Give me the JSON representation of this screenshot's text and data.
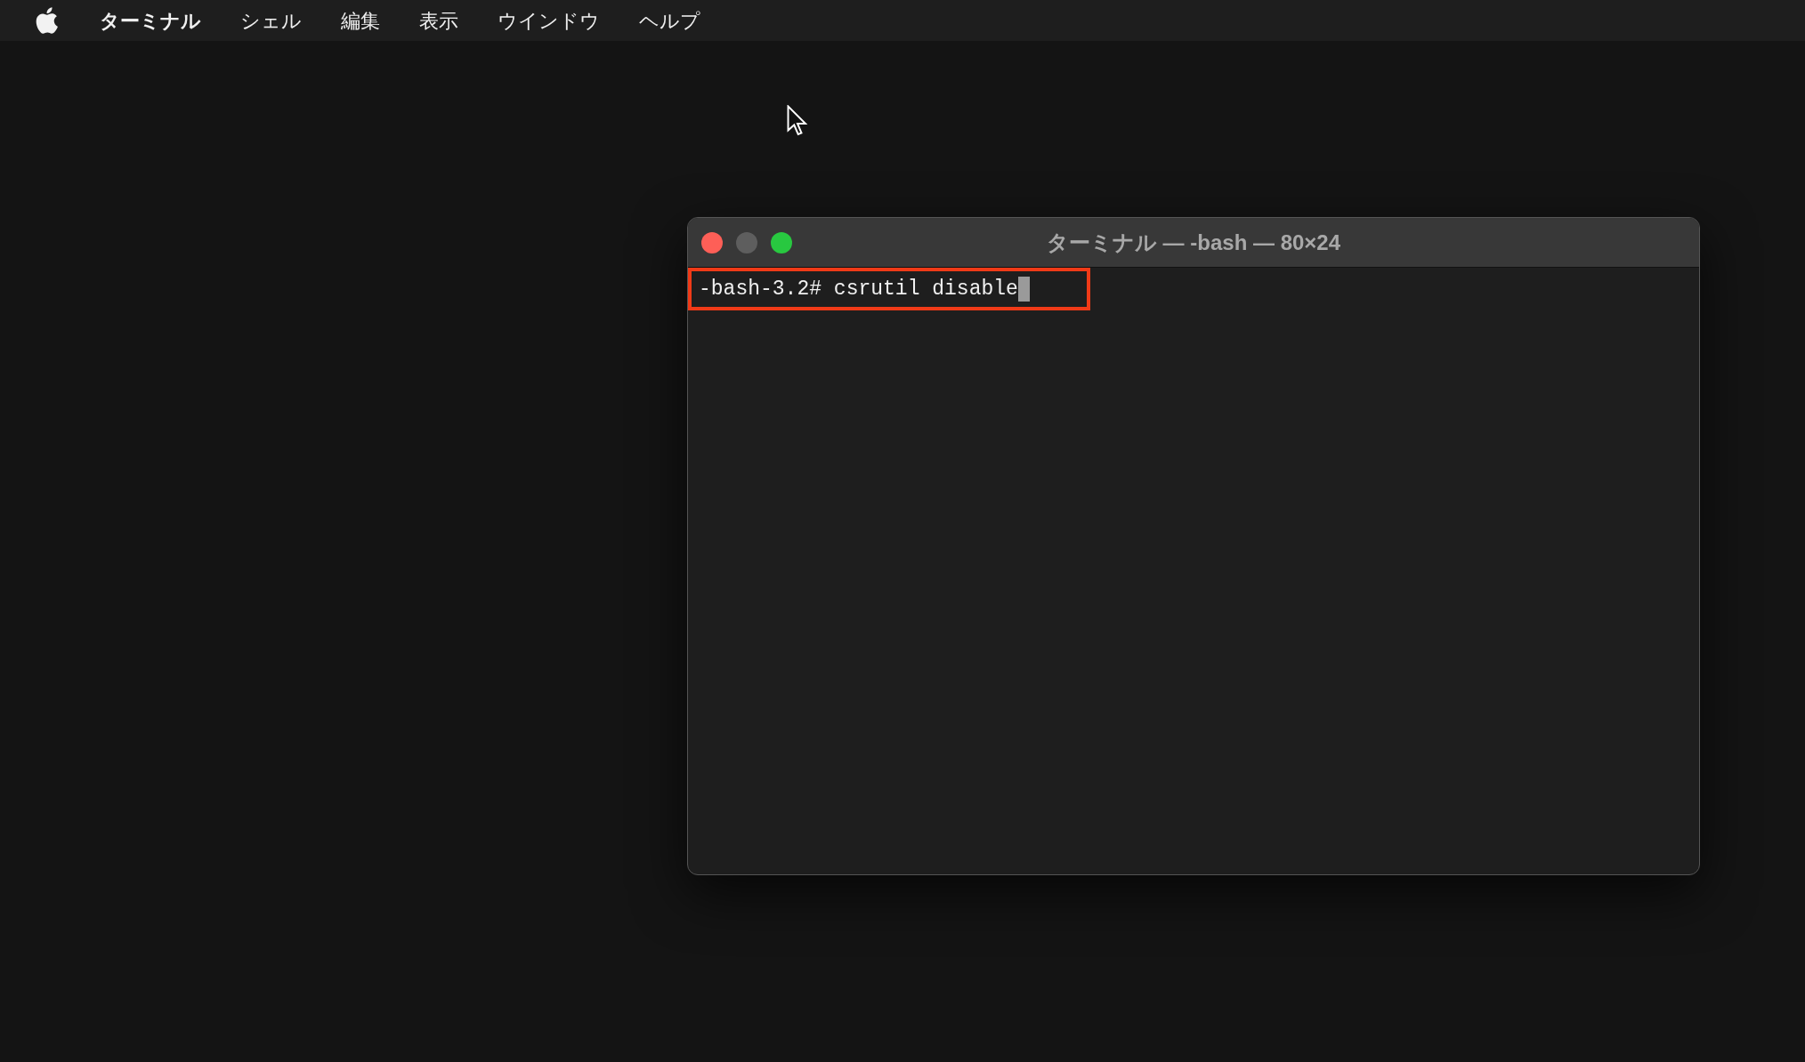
{
  "menu_bar": {
    "items": [
      {
        "label": "ターミナル",
        "kind": "app"
      },
      {
        "label": "シェル",
        "kind": "menu"
      },
      {
        "label": "編集",
        "kind": "menu"
      },
      {
        "label": "表示",
        "kind": "menu"
      },
      {
        "label": "ウインドウ",
        "kind": "menu"
      },
      {
        "label": "ヘルプ",
        "kind": "menu"
      }
    ]
  },
  "terminal": {
    "title": "ターミナル — -bash — 80×24",
    "lines": [
      {
        "text": "-bash-3.2# csrutil disable",
        "highlighted": true
      }
    ]
  }
}
